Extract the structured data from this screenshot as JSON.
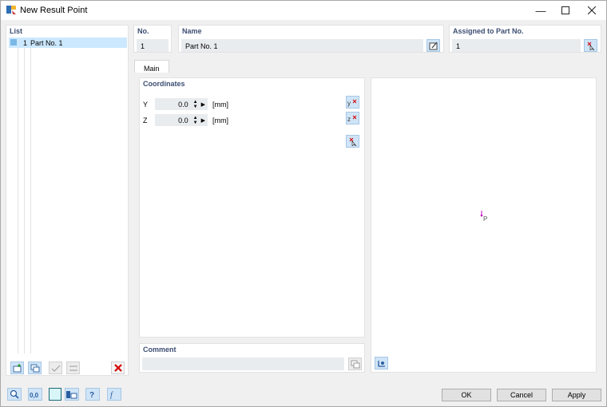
{
  "window": {
    "title": "New Result Point"
  },
  "list": {
    "label": "List",
    "items": [
      {
        "number": "1",
        "name": "Part No. 1"
      }
    ]
  },
  "no": {
    "label": "No.",
    "value": "1"
  },
  "name": {
    "label": "Name",
    "value": "Part No. 1"
  },
  "assigned": {
    "label": "Assigned to Part No.",
    "value": "1"
  },
  "tabs": [
    {
      "label": "Main"
    }
  ],
  "coordinates": {
    "label": "Coordinates",
    "rows": [
      {
        "axis": "Y",
        "value": "0.0",
        "unit": "[mm]"
      },
      {
        "axis": "Z",
        "value": "0.0",
        "unit": "[mm]"
      }
    ]
  },
  "preview": {
    "point_label": "P"
  },
  "comment": {
    "label": "Comment",
    "value": ""
  },
  "buttons": {
    "ok": "OK",
    "cancel": "Cancel",
    "apply": "Apply"
  },
  "colors": {
    "accent_label": "#3c4e72",
    "selection": "#cce8ff",
    "delete": "#d40000",
    "point": "#c000c0"
  }
}
